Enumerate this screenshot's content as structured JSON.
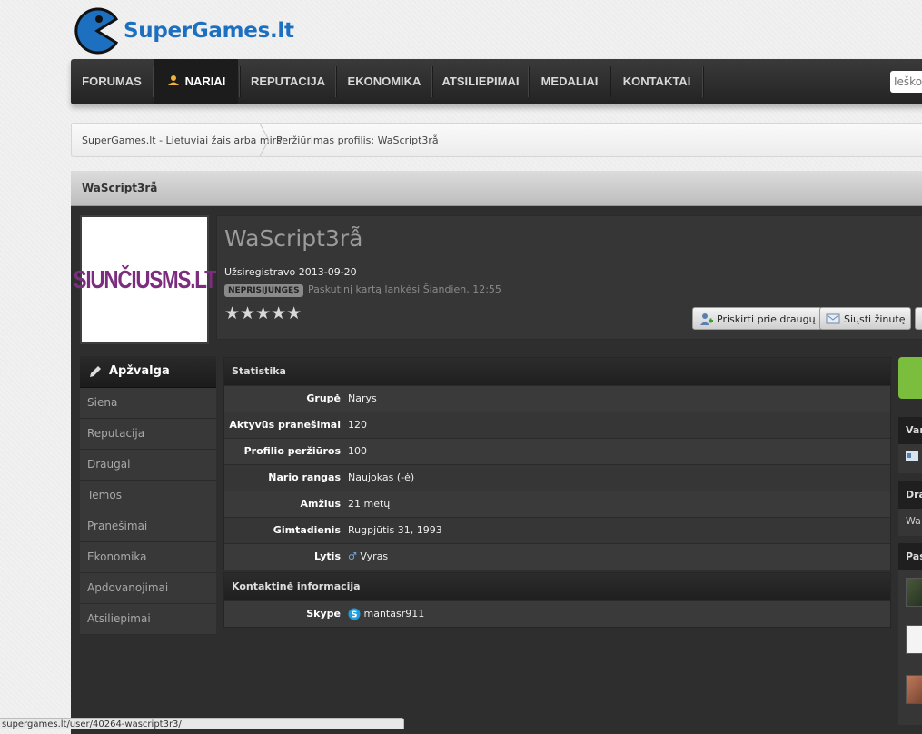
{
  "brand": {
    "name": "SuperGames.lt",
    "accent": "#1d6fbf"
  },
  "nav": {
    "items": [
      {
        "label": "FORUMAS"
      },
      {
        "label": "NARIAI",
        "active": true
      },
      {
        "label": "REPUTACIJA"
      },
      {
        "label": "EKONOMIKA"
      },
      {
        "label": "ATSILIEPIMAI"
      },
      {
        "label": "MEDALIAI"
      },
      {
        "label": "KONTAKTAI"
      }
    ],
    "search_placeholder": "Ieškoti"
  },
  "breadcrumb": {
    "home": "SuperGames.lt - Lietuviai žais arba mirs",
    "current": "Peržiūrimas profilis: WaScript3rẫ"
  },
  "profile": {
    "header_title": "WaScript3rẫ",
    "username": "WaScript3rẫ",
    "avatar_text": "SIUNČIUSMS.LT",
    "registered": "Užsiregistravo 2013-09-20",
    "status_badge": "NEPRISIJUNGĘS",
    "last_visit": "Paskutinį kartą lankėsi Šiandien, 12:55",
    "stars": "★★★★★",
    "add_friend_label": "Priskirti prie draugų",
    "send_message_label": "Siųsti žinutę"
  },
  "sidebar": {
    "header": "Apžvalga",
    "items": [
      {
        "label": "Siena"
      },
      {
        "label": "Reputacija"
      },
      {
        "label": "Draugai"
      },
      {
        "label": "Temos"
      },
      {
        "label": "Pranešimai"
      },
      {
        "label": "Ekonomika"
      },
      {
        "label": "Apdovanojimai"
      },
      {
        "label": "Atsiliepimai"
      }
    ]
  },
  "stats": {
    "title": "Statistika",
    "rows": [
      {
        "label": "Grupė",
        "value": "Narys"
      },
      {
        "label": "Aktyvūs pranešimai",
        "value": "120"
      },
      {
        "label": "Profilio peržiūros",
        "value": "100"
      },
      {
        "label": "Nario rangas",
        "value": "Naujokas (-ė)"
      },
      {
        "label": "Amžius",
        "value": "21 metų"
      },
      {
        "label": "Gimtadienis",
        "value": "Rugpjūtis 31, 1993"
      },
      {
        "label": "Lytis",
        "value": "Vyras"
      }
    ]
  },
  "contact": {
    "title": "Kontaktinė informacija",
    "skype_label": "Skype",
    "skype_value": "mantasr911"
  },
  "right": {
    "box1": "Var",
    "box2": "Dra",
    "box2_body": "Wa",
    "box3": "Pas"
  },
  "statusbar": {
    "url": "supergames.lt/user/40264-wascript3r3/"
  }
}
